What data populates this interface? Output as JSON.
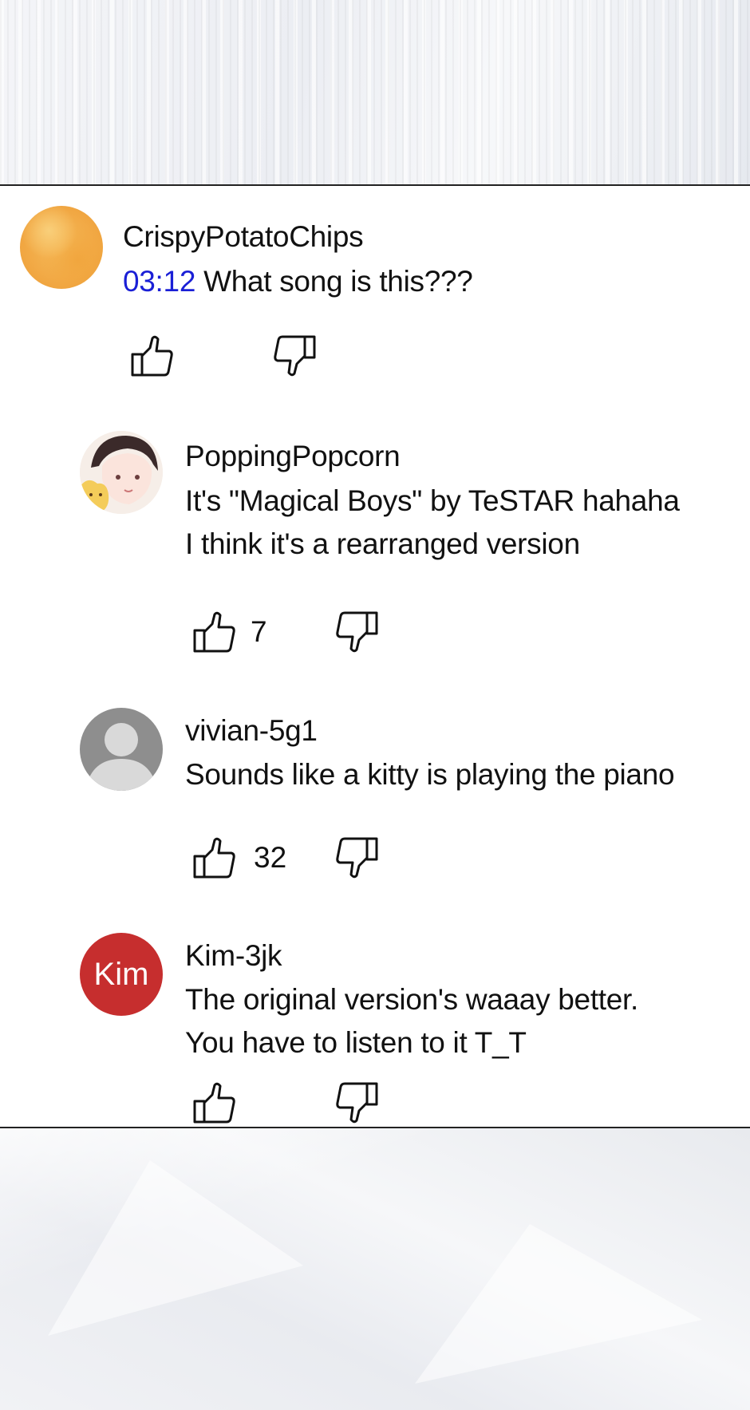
{
  "comments": [
    {
      "username": "CrispyPotatoChips",
      "timestamp": "03:12",
      "text": "What song is this???",
      "like_count": "",
      "avatar": "potato-chips-avatar"
    },
    {
      "username": "PoppingPopcorn",
      "line1": "It's \"Magical Boys\" by TeSTAR hahaha",
      "line2": "I think it's a rearranged version",
      "like_count": "7",
      "avatar": "anime-character-avatar"
    },
    {
      "username": "vivian-5g1",
      "line1": "Sounds like a kitty is playing the piano",
      "like_count": "32",
      "avatar": "default-user-avatar"
    },
    {
      "username": "Kim-3jk",
      "avatar_text": "Kim",
      "line1": "The original version's waaay better.",
      "line2": "You have to listen to it T_T",
      "like_count": "",
      "avatar": "kim-initials-avatar"
    }
  ],
  "colors": {
    "timestamp": "#1a1fd6",
    "kim_avatar": "#c62e2e",
    "default_avatar": "#8e8e8e"
  },
  "icons": [
    "thumbs-up-icon",
    "thumbs-down-icon"
  ]
}
